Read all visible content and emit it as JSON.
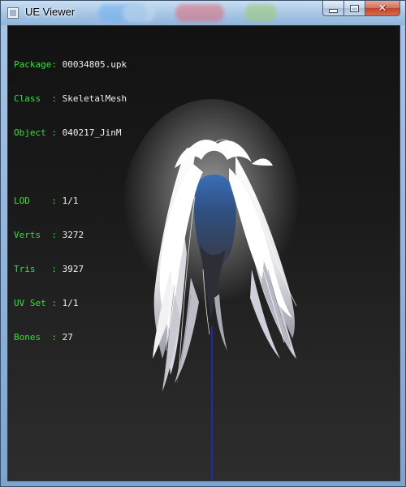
{
  "window": {
    "title": "UE Viewer",
    "icon": "app-window-icon",
    "controls": {
      "minimize_icon": "minimize-icon",
      "maximize_icon": "maximize-icon",
      "close_glyph": "✕"
    }
  },
  "info_overlay": {
    "mesh": [
      {
        "label": "Package:",
        "value": "00034805.upk"
      },
      {
        "label": "Class  :",
        "value": "SkeletalMesh"
      },
      {
        "label": "Object :",
        "value": "040217_JinM"
      }
    ],
    "stats": [
      {
        "label": "LOD    :",
        "value": "1/1"
      },
      {
        "label": "Verts  :",
        "value": "3272"
      },
      {
        "label": "Tris   :",
        "value": "3927"
      },
      {
        "label": "UV Set :",
        "value": "1/1"
      },
      {
        "label": "Bones  :",
        "value": "27"
      }
    ],
    "label_color": "#2ee52e",
    "value_color": "#f0f0f0"
  },
  "viewport": {
    "background": "#1a1a1a",
    "axis_color": "#1a2bd6",
    "model": "white-hair-mesh"
  }
}
